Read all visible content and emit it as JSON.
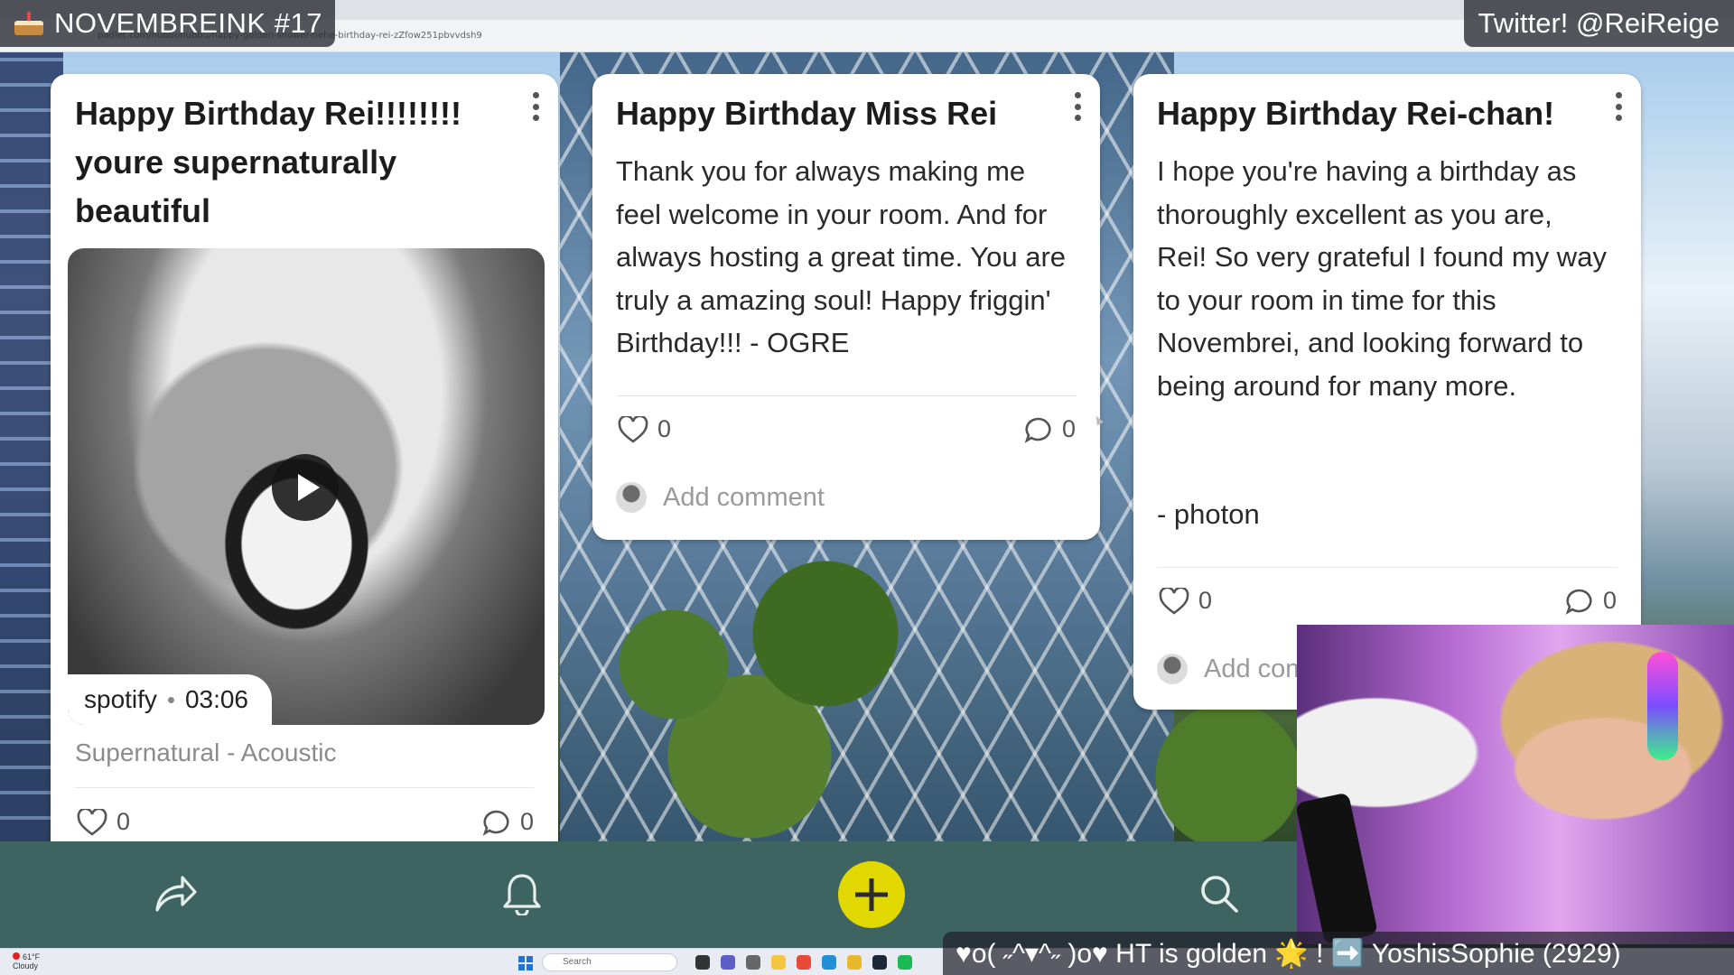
{
  "stream": {
    "title": "NOVEMBREINK #17",
    "twitter": "Twitter! @ReiReige",
    "ticker": "♥o( ˶^▾^˶ )o♥ HT is golden 🌟 ! ➡️ YoshisSophie (2929)"
  },
  "browser": {
    "url": "padlet.com/hubbunubbu/happy-golden-shower-hehe-birthday-rei-zZfow251pbvvdsh9"
  },
  "cards": [
    {
      "title": "Happy Birthday Rei!!!!!!!! youre supernaturally beautiful",
      "media": {
        "source": "spotify",
        "duration": "03:06",
        "caption": "Supernatural - Acoustic"
      },
      "likes": "0",
      "comments": "0"
    },
    {
      "title": "Happy Birthday Miss Rei",
      "body": "Thank you for always making me feel welcome in your room. And for always hosting a great time. You are truly a amazing soul! Happy friggin' Birthday!!! - OGRE",
      "likes": "0",
      "comments": "0",
      "comment_placeholder": "Add comment"
    },
    {
      "title": "Happy Birthday Rei-chan!",
      "body": "I hope you're having a birthday as thoroughly excellent as you are, Rei! So very grateful I found my way to your room in time for this Novembrei, and looking forward to being around for many more.",
      "signature": "- photon",
      "likes": "0",
      "comments": "0",
      "comment_placeholder": "Add comment"
    }
  ],
  "taskbar": {
    "temperature": "61°F",
    "weather": "Cloudy",
    "search_placeholder": "Search"
  },
  "icons": [
    "share-icon",
    "bell-icon",
    "plus-icon",
    "search-icon",
    "heart-icon",
    "comment-icon",
    "kebab-icon",
    "play-icon"
  ],
  "colors": {
    "bottom_bar": "#3d6460",
    "fab": "#e1d800",
    "card": "#ffffff"
  }
}
